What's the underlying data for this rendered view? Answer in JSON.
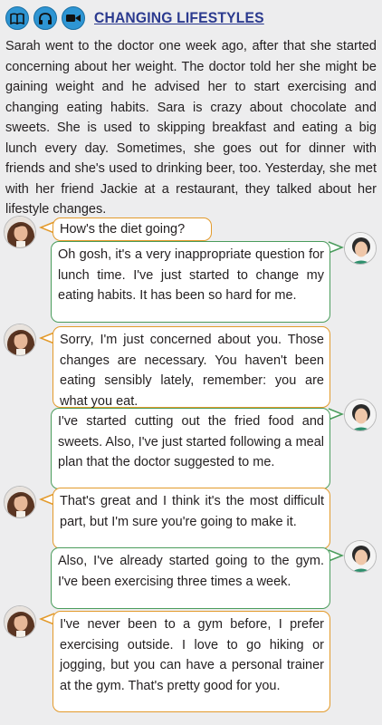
{
  "header": {
    "title": "CHANGING LIFESTYLES",
    "icons": [
      "book-icon",
      "headphones-icon",
      "video-camera-icon"
    ],
    "icon_color": "#2e95d3"
  },
  "intro": "Sarah went to the doctor one week ago, after that she started concerning about her weight. The doctor told her she might be gaining weight and he advised her to start exercising and changing eating habits. Sara is crazy about chocolate and sweets. She is used to skipping breakfast and eating a big lunch every day. Sometimes, she goes out for dinner with friends and she's used to drinking beer, too. Yesterday, she met with her friend Jackie at a restaurant, they talked about her lifestyle changes.",
  "colors": {
    "speaker_a_border": "#e39a2b",
    "speaker_b_border": "#4a9c5c",
    "title": "#2b3a8f"
  },
  "dialogue": [
    {
      "speaker": "a",
      "text": "How's the diet going?"
    },
    {
      "speaker": "b",
      "text": "Oh gosh, it's a very inappropriate question for lunch time. I've just started to change my eating habits. It has been so hard for me."
    },
    {
      "speaker": "a",
      "text": "Sorry, I'm just concerned about you. Those changes are necessary. You haven't been eating sensibly lately, remember: you are what you eat."
    },
    {
      "speaker": "b",
      "text": "I've started cutting out the fried food and sweets. Also, I've just started following a meal plan that the doctor suggested to me."
    },
    {
      "speaker": "a",
      "text": "That's great and I think it's the most difficult part, but I'm sure you're going to make it."
    },
    {
      "speaker": "b",
      "text": "Also, I've already started going to the gym. I've been exercising three times a week."
    },
    {
      "speaker": "a",
      "text": "I've never been to a gym before, I prefer exercising outside. I love to go hiking or jogging, but you can have a personal trainer at the gym. That's pretty good for you."
    }
  ]
}
